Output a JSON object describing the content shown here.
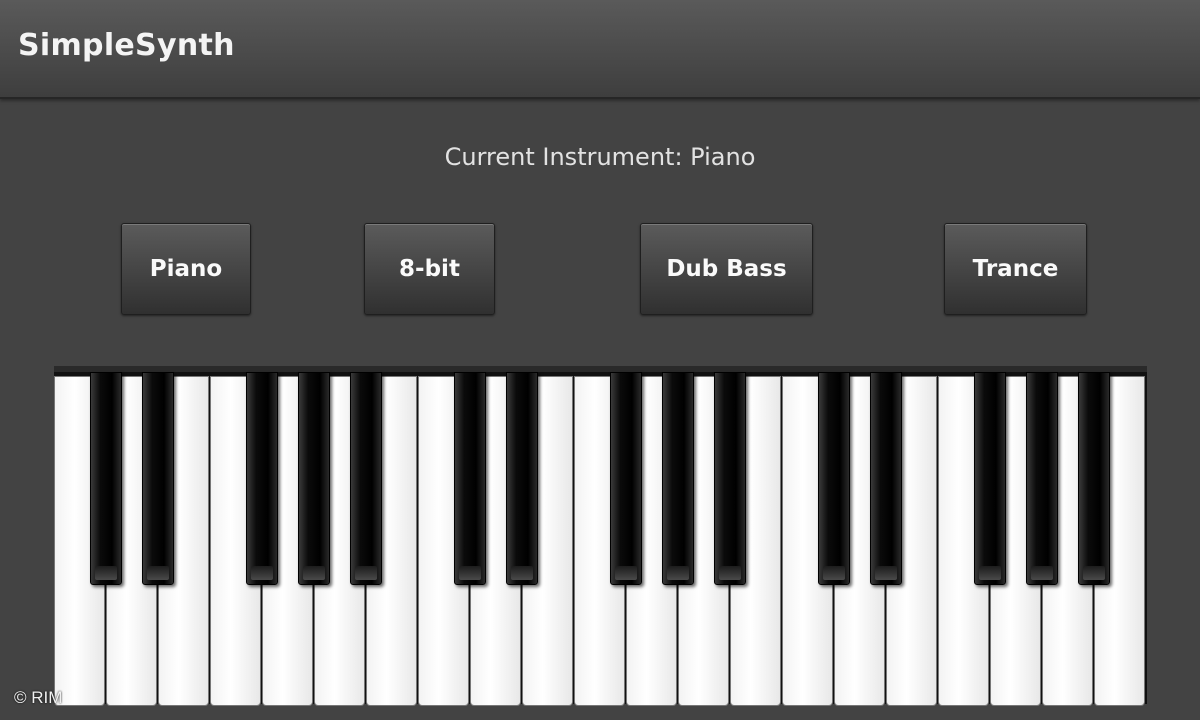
{
  "app": {
    "title": "SimpleSynth"
  },
  "status": {
    "current_instrument": "Current Instrument: Piano"
  },
  "instruments": [
    {
      "label": "Piano"
    },
    {
      "label": "8-bit"
    },
    {
      "label": "Dub Bass"
    },
    {
      "label": "Trance"
    }
  ],
  "keyboard": {
    "white_keys": 21,
    "black_keys": 15
  },
  "footer": {
    "copyright": "© RIM"
  }
}
